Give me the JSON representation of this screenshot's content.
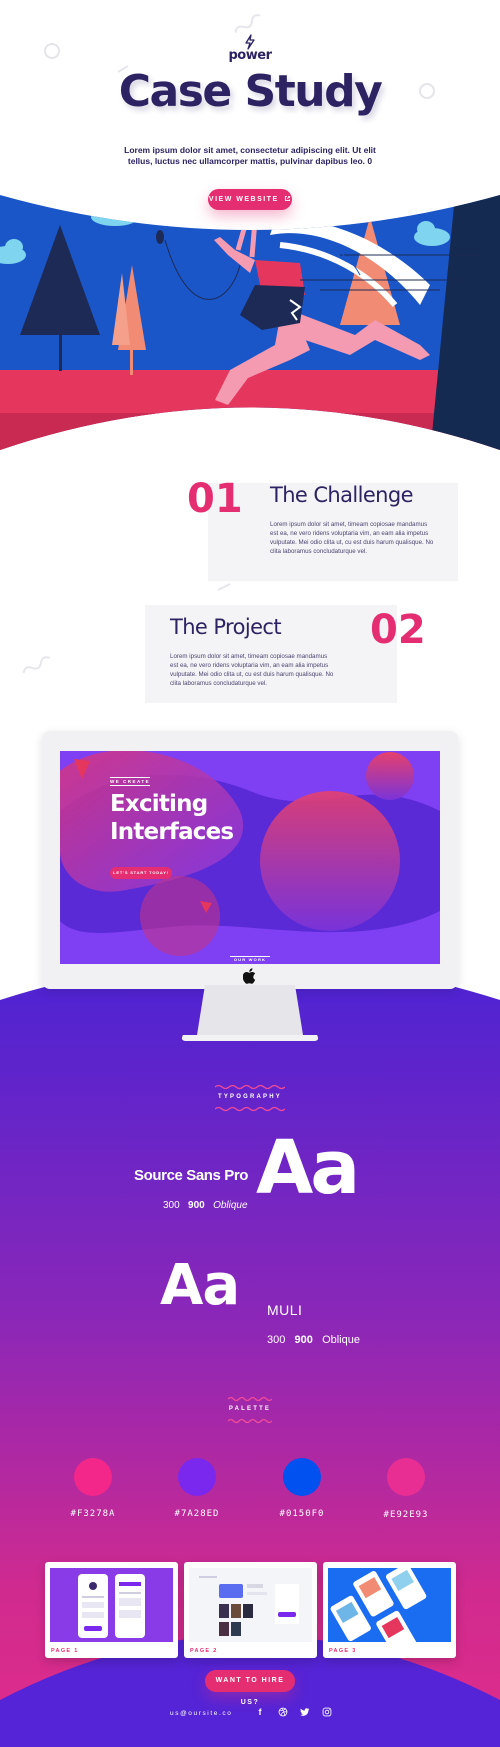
{
  "brand": {
    "logo_text": "power"
  },
  "hero": {
    "title": "Case Study",
    "text": "Lorem ipsum dolor sit amet, consectetur adipiscing elit. Ut elit tellus, luctus nec ullamcorper mattis, pulvinar dapibus leo. 0",
    "button_label": "VIEW WEBSITE",
    "button_icon": "external-link-icon"
  },
  "sections": [
    {
      "number": "01",
      "title": "The Challenge",
      "body": "Lorem ipsum dolor sit amet, timeam copiosae mandamus est ea, ne vero ridens voluptaria vim, an eam alia impetus vulputate. Mei odio clita ut, cu est duis harum qualisque. No clita laboramus concludaturque vel."
    },
    {
      "number": "02",
      "title": "The Project",
      "body": "Lorem ipsum dolor sit amet, timeam copiosae mandamus est ea, ne vero ridens voluptaria vim, an eam alia impetus vulputate. Mei odio clita ut, cu est duis harum qualisque. No clita laboramus concludaturque vel."
    }
  ],
  "monitor_screen": {
    "eyebrow": "WE CREATE",
    "headline_line1": "Exciting",
    "headline_line2": "Interfaces",
    "cta_label": "LET'S START TODAY!",
    "bottom_label": "OUR WORK",
    "brand_icon": "apple-logo-icon"
  },
  "typography": {
    "label": "TYPOGRAPHY",
    "font1": {
      "name": "Source Sans Pro",
      "sample": "Aa",
      "weight_light": "300",
      "weight_bold": "900",
      "style": "Oblique"
    },
    "font2": {
      "name": "MULI",
      "sample": "Aa",
      "weight_light": "300",
      "weight_bold": "900",
      "style": "Oblique"
    }
  },
  "palette": {
    "label": "PALETTE",
    "colors": [
      {
        "hex": "#F3278A",
        "color": "#F3278A"
      },
      {
        "hex": "#7A28ED",
        "color": "#7A28ED"
      },
      {
        "hex": "#0150F0",
        "color": "#0150F0"
      },
      {
        "hex": "#E92E93",
        "color": "#E92E93"
      }
    ]
  },
  "pages": [
    {
      "label": "PAGE 1"
    },
    {
      "label": "PAGE 2"
    },
    {
      "label": "PAGE 3"
    }
  ],
  "footer": {
    "hire_button_label": "WANT TO HIRE US?",
    "email": "us@oursite.co",
    "social_icons": [
      "facebook-icon",
      "dribbble-icon",
      "twitter-icon",
      "instagram-icon"
    ]
  },
  "colors": {
    "navy": "#2d2363",
    "accent_pink": "#e52e71",
    "purple": "#5524d6"
  }
}
